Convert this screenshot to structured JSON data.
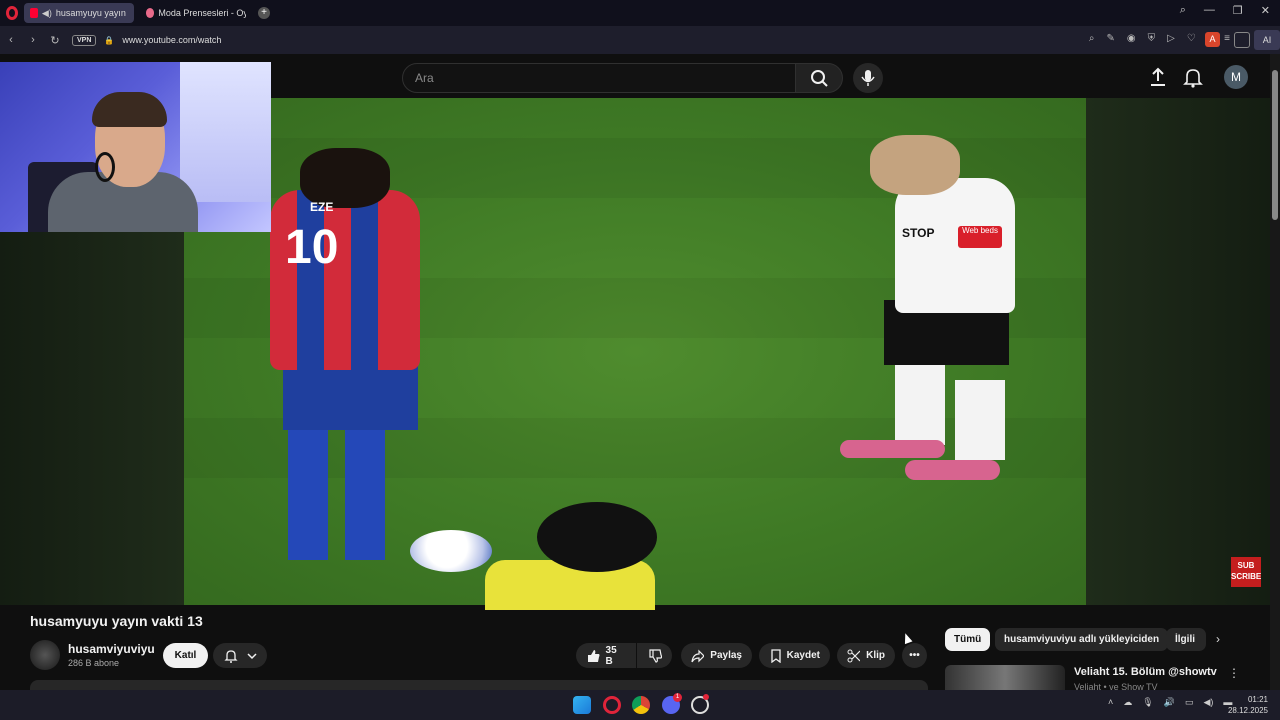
{
  "browser": {
    "tabs": [
      {
        "title": "husamyuyu yayın vakti",
        "active": true,
        "favicon": "youtube-icon",
        "audio": true
      },
      {
        "title": "Moda Prensesleri - Oyunu",
        "active": false,
        "favicon": "game-icon"
      }
    ],
    "vpn_label": "VPN",
    "url": "www.youtube.com/watch",
    "profile_letter": "A",
    "ai_label": "AI"
  },
  "youtube": {
    "search_placeholder": "Ara",
    "user_avatar_letter": "M",
    "video": {
      "title": "husamyuyu yayın vakti 13",
      "overlay_player_name": "EZE",
      "overlay_player_number": "10",
      "overlay_sponsor": "STOP",
      "overlay_sponsor2": "Web beds",
      "subscribe_logo": "SUB SCRIBE"
    },
    "channel": {
      "name": "husamviyuviyu",
      "subscribers": "286 B abone",
      "join_label": "Katıl"
    },
    "actions": {
      "likes": "35 B",
      "share": "Paylaş",
      "save": "Kaydet",
      "clip": "Klip"
    },
    "chips": [
      "Tümü",
      "husamviyuviyu adlı yükleyiciden",
      "İlgili"
    ],
    "recommendation": {
      "title": "Veliaht 15. Bölüm @showtv",
      "channel": "Veliaht • ve Show TV"
    }
  },
  "taskbar": {
    "discord_badge": "1",
    "time": "01:21",
    "date": "28.12.2025"
  },
  "colors": {
    "youtube_red": "#ff0033",
    "opera_red": "#e0243a",
    "background": "#0f0f0f"
  }
}
